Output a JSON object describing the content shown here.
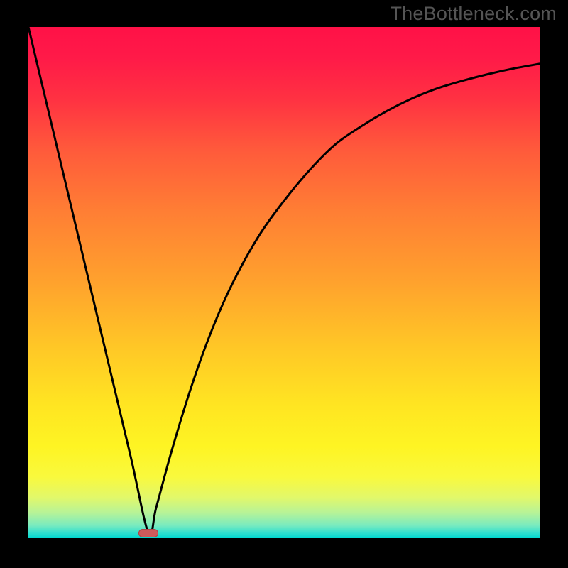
{
  "attribution": "TheBottleneck.com",
  "colors": {
    "curve_stroke": "#000000",
    "marker_fill": "#cf5a5b",
    "marker_stroke": "#b04448",
    "frame": "#000000"
  },
  "chart_data": {
    "type": "line",
    "title": "",
    "xlabel": "",
    "ylabel": "",
    "xlim": [
      0,
      100
    ],
    "ylim": [
      0,
      100
    ],
    "grid": false,
    "legend": false,
    "annotations": [],
    "series": [
      {
        "name": "curve",
        "x": [
          0,
          5,
          10,
          15,
          20,
          23.5,
          25,
          28,
          32,
          36,
          40,
          45,
          50,
          55,
          60,
          65,
          70,
          75,
          80,
          85,
          90,
          95,
          100
        ],
        "values": [
          100,
          79,
          58,
          37,
          16,
          1,
          6,
          17,
          30,
          41,
          50,
          59,
          66,
          72,
          77,
          80.5,
          83.5,
          86,
          88,
          89.5,
          90.8,
          91.9,
          92.8
        ]
      }
    ],
    "marker": {
      "x": 23.5,
      "y": 1
    },
    "background_gradient": {
      "orientation": "vertical",
      "stops": [
        {
          "pos": 0.0,
          "color": "#ff1147"
        },
        {
          "pos": 0.5,
          "color": "#ffa22d"
        },
        {
          "pos": 0.82,
          "color": "#fef423"
        },
        {
          "pos": 1.0,
          "color": "#00d8d0"
        }
      ]
    }
  }
}
